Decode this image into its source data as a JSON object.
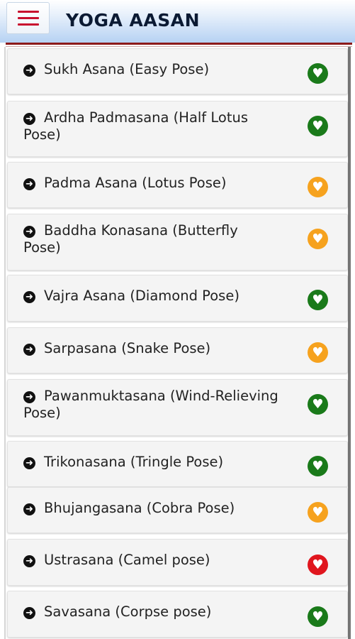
{
  "header": {
    "title": "YOGA AASAN",
    "menu_icon": "hamburger-icon"
  },
  "colors": {
    "green": "#1a7a1a",
    "orange": "#f6a21e",
    "red": "#e0161e",
    "accent": "#c8102e"
  },
  "items": [
    {
      "label": "Sukh Asana (Easy Pose)",
      "level": "green"
    },
    {
      "label": "Ardha Padmasana (Half Lotus Pose)",
      "level": "green"
    },
    {
      "label": "Padma Asana (Lotus Pose)",
      "level": "orange"
    },
    {
      "label": "Baddha Konasana (Butterfly Pose)",
      "level": "orange"
    },
    {
      "label": "Vajra Asana (Diamond Pose)",
      "level": "green"
    },
    {
      "label": "Sarpasana (Snake Pose)",
      "level": "orange"
    },
    {
      "label": "Pawanmuktasana (Wind-Relieving Pose)",
      "level": "green"
    },
    {
      "label": "Trikonasana (Tringle Pose)",
      "level": "green"
    },
    {
      "label": "Bhujangasana (Cobra Pose)",
      "level": "orange"
    },
    {
      "label": "Ustrasana (Camel pose)",
      "level": "red"
    },
    {
      "label": "Savasana (Corpse pose)",
      "level": "green"
    }
  ]
}
